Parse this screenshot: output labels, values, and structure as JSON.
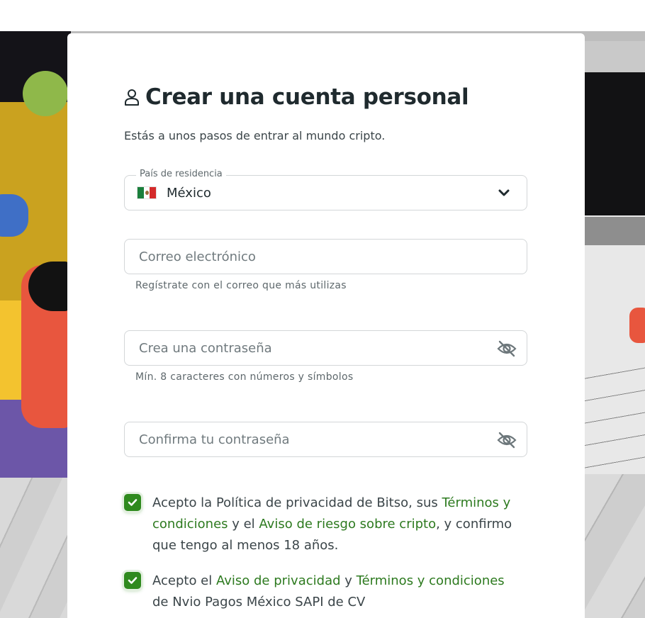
{
  "title": "Crear una cuenta personal",
  "subtitle": "Estás a unos pasos de entrar al mundo cripto.",
  "country": {
    "legend": "País de residencia",
    "value": "México"
  },
  "email": {
    "placeholder": "Correo electrónico",
    "hint": "Regístrate con el correo que más utilizas"
  },
  "password": {
    "placeholder": "Crea una contraseña",
    "hint": "Mín. 8 caracteres con números y símbolos"
  },
  "confirm_password": {
    "placeholder": "Confirma tu contraseña"
  },
  "consent_1": {
    "checked": true,
    "text_a": "Acepto la Política de privacidad de Bitso, sus ",
    "link_terms": "Términos y condiciones",
    "text_b": " y el ",
    "link_risk": "Aviso de riesgo sobre cripto",
    "text_c": ", y confirmo que tengo al menos 18 años."
  },
  "consent_2": {
    "checked": true,
    "text_a": "Acepto el ",
    "link_privacy": "Aviso de privacidad",
    "text_b": " y ",
    "link_terms": "Términos y condiciones",
    "text_c": " de Nvio Pagos México SAPI de CV"
  },
  "colors": {
    "accent_green": "#2f8a1e",
    "link_green": "#2d7a1f",
    "text": "#1f2a2e"
  },
  "icons": {
    "title": "user-icon",
    "select": "chevron-down-icon",
    "password_toggle": "eye-off-icon",
    "checkbox": "check-icon"
  }
}
